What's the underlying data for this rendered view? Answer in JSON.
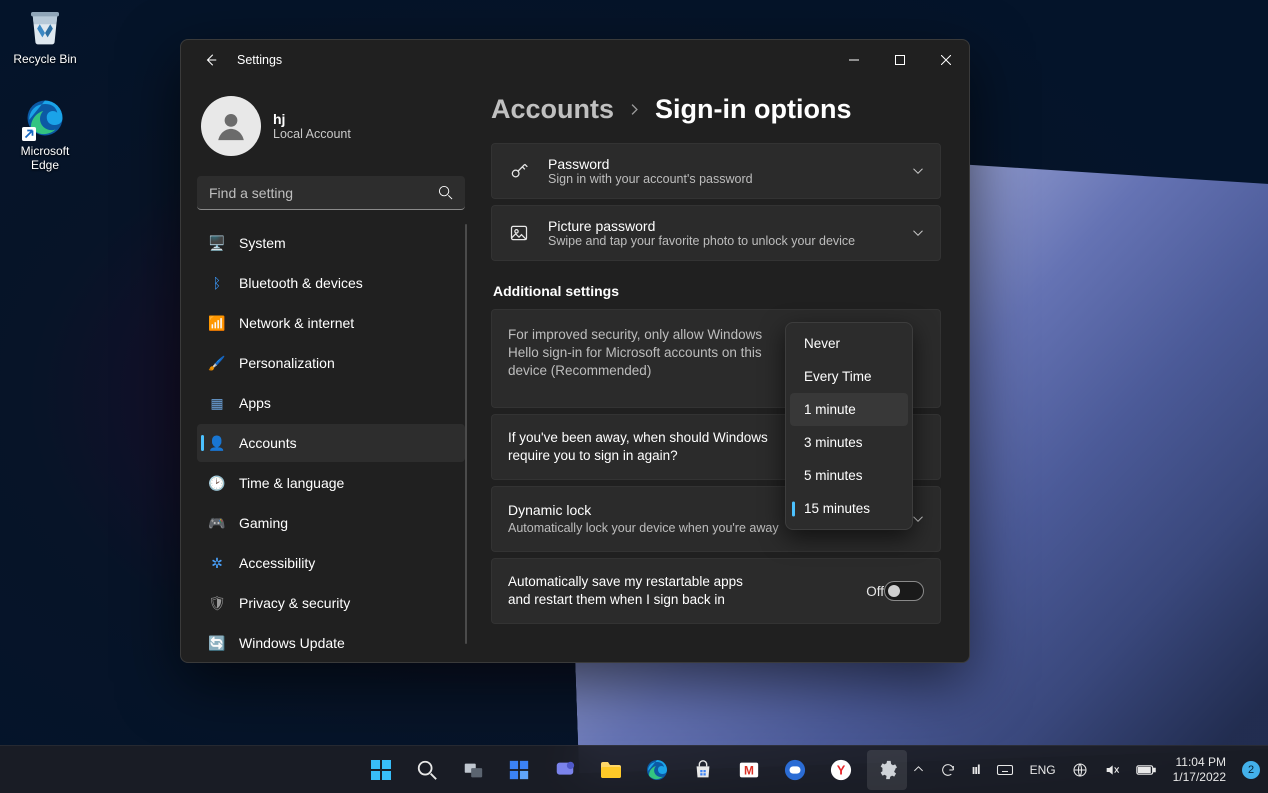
{
  "desktop": {
    "icons": [
      {
        "name": "recycle-bin",
        "label": "Recycle Bin"
      },
      {
        "name": "microsoft-edge",
        "label": "Microsoft Edge"
      }
    ]
  },
  "window": {
    "title": "Settings",
    "profile": {
      "name": "hj",
      "type": "Local Account"
    },
    "search_placeholder": "Find a setting",
    "nav": [
      {
        "key": "system",
        "label": "System",
        "icon": "🖥️",
        "color": "#4aa3ff"
      },
      {
        "key": "bluetooth",
        "label": "Bluetooth & devices",
        "icon": "ᛒ",
        "color": "#3b9bff"
      },
      {
        "key": "network",
        "label": "Network & internet",
        "icon": "📶",
        "color": "#3b9bff"
      },
      {
        "key": "personalization",
        "label": "Personalization",
        "icon": "🖌️",
        "color": "#d58a3c"
      },
      {
        "key": "apps",
        "label": "Apps",
        "icon": "▦",
        "color": "#6aa0d8"
      },
      {
        "key": "accounts",
        "label": "Accounts",
        "icon": "👤",
        "color": "#46c36c",
        "active": true
      },
      {
        "key": "time",
        "label": "Time & language",
        "icon": "🕑",
        "color": "#7bb3e8"
      },
      {
        "key": "gaming",
        "label": "Gaming",
        "icon": "🎮",
        "color": "#9a9a9a"
      },
      {
        "key": "accessibility",
        "label": "Accessibility",
        "icon": "✲",
        "color": "#4aa3ff"
      },
      {
        "key": "privacy",
        "label": "Privacy & security",
        "icon": "🛡",
        "color": "#9a9a9a"
      },
      {
        "key": "update",
        "label": "Windows Update",
        "icon": "🔄",
        "color": "#3b9bff"
      }
    ],
    "breadcrumb": {
      "parent": "Accounts",
      "current": "Sign-in options"
    },
    "options": {
      "password": {
        "title": "Password",
        "sub": "Sign in with your account's password"
      },
      "picture": {
        "title": "Picture password",
        "sub": "Swipe and tap your favorite photo to unlock your device"
      }
    },
    "additional_title": "Additional settings",
    "hello": {
      "text": "For improved security, only allow Windows Hello sign-in for Microsoft accounts on this device (Recommended)"
    },
    "away": {
      "text": "If you've been away, when should Windows require you to sign in again?"
    },
    "dynamic": {
      "title": "Dynamic lock",
      "sub": "Automatically lock your device when you're away"
    },
    "restart": {
      "text": "Automatically save my restartable apps and restart them when I sign back in",
      "status": "Off"
    },
    "dropdown": {
      "items": [
        "Never",
        "Every Time",
        "1 minute",
        "3 minutes",
        "5 minutes",
        "15 minutes"
      ],
      "hovered": "1 minute",
      "selected": "15 minutes"
    }
  },
  "taskbar": {
    "lang": "ENG",
    "time": "11:04 PM",
    "date": "1/17/2022",
    "notif_count": "2"
  }
}
